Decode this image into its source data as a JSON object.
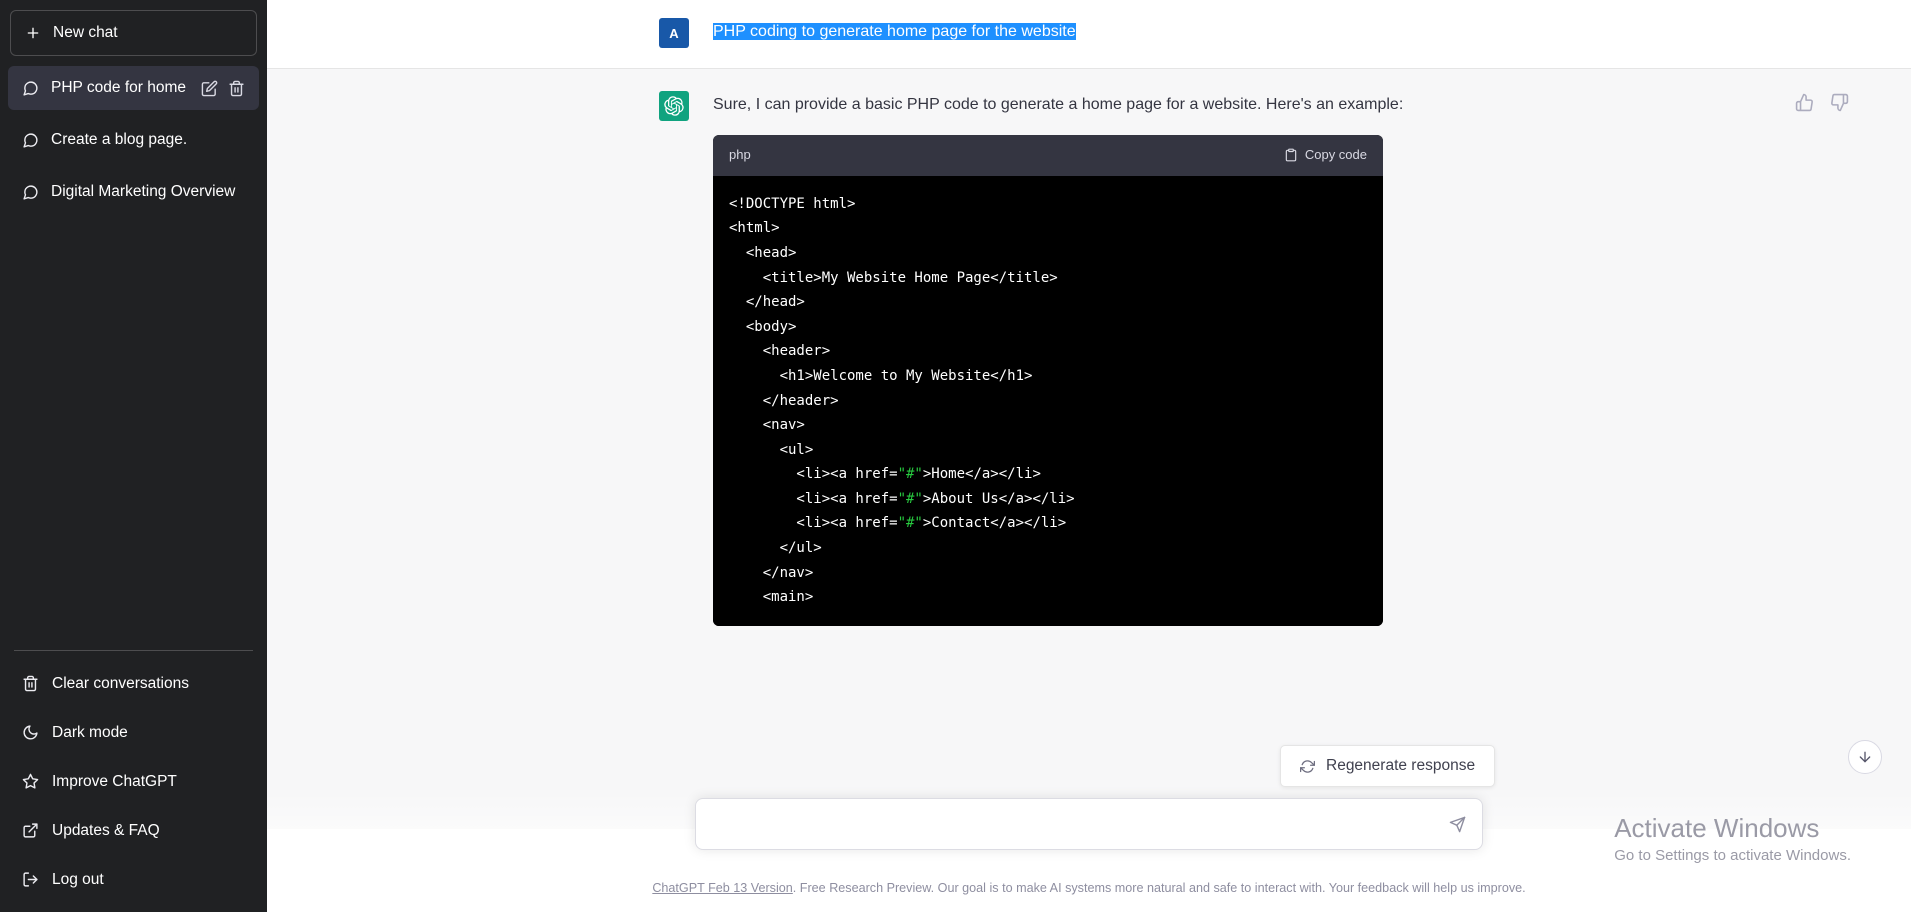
{
  "sidebar": {
    "new_chat_label": "New chat",
    "conversations": [
      {
        "label": "PHP code for home pag",
        "active": true
      },
      {
        "label": "Create a blog page.",
        "active": false
      },
      {
        "label": "Digital Marketing Overview",
        "active": false
      }
    ],
    "menu": [
      {
        "label": "Clear conversations",
        "icon": "trash-icon"
      },
      {
        "label": "Dark mode",
        "icon": "moon-icon"
      },
      {
        "label": "Improve ChatGPT",
        "icon": "star-icon"
      },
      {
        "label": "Updates & FAQ",
        "icon": "external-link-icon"
      },
      {
        "label": "Log out",
        "icon": "logout-icon"
      }
    ]
  },
  "conversation": {
    "user": {
      "avatar_initial": "A",
      "text": "PHP coding to generate home page for the website"
    },
    "assistant": {
      "paragraph": "Sure, I can provide a basic PHP code to generate a home page for a website. Here's an example:",
      "code_language": "php",
      "copy_label": "Copy code",
      "code_lines": [
        {
          "text": "<!DOCTYPE html>"
        },
        {
          "text": "<html>"
        },
        {
          "text": "  <head>"
        },
        {
          "text": "    <title>My Website Home Page</title>"
        },
        {
          "text": "  </head>"
        },
        {
          "text": "  <body>"
        },
        {
          "text": "    <header>"
        },
        {
          "text": "      <h1>Welcome to My Website</h1>"
        },
        {
          "text": "    </header>"
        },
        {
          "text": "    <nav>"
        },
        {
          "text": "      <ul>"
        },
        {
          "text": "        <li><a href=",
          "str": "\"#\"",
          "tail": ">Home</a></li>"
        },
        {
          "text": "        <li><a href=",
          "str": "\"#\"",
          "tail": ">About Us</a></li>"
        },
        {
          "text": "        <li><a href=",
          "str": "\"#\"",
          "tail": ">Contact</a></li>"
        },
        {
          "text": "      </ul>"
        },
        {
          "text": "    </nav>"
        },
        {
          "text": "    <main>"
        }
      ]
    }
  },
  "actions": {
    "regenerate_label": "Regenerate response",
    "thumbs_up": "thumbs-up-icon",
    "thumbs_down": "thumbs-down-icon",
    "scroll_to_bottom": "arrow-down-icon"
  },
  "composer": {
    "value": "",
    "placeholder": ""
  },
  "footer": {
    "link_text": "ChatGPT Feb 13 Version",
    "rest_text": ". Free Research Preview. Our goal is to make AI systems more natural and safe to interact with. Your feedback will help us improve."
  },
  "watermark": {
    "title": "Activate Windows",
    "subtitle": "Go to Settings to activate Windows."
  },
  "colors": {
    "sidebar_bg": "#202123",
    "active_item": "#343541",
    "assistant_bg": "#f7f7f8",
    "brand_green": "#10a37f",
    "user_avatar": "#1858a8",
    "selection_blue": "#1e90ff",
    "code_string": "#27c93f"
  }
}
